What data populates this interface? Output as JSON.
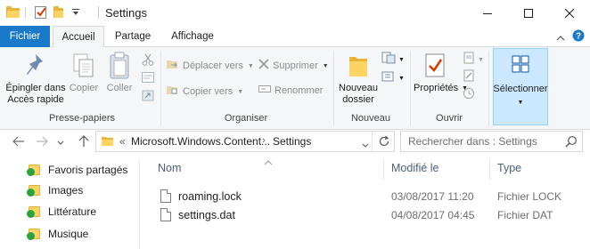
{
  "window": {
    "title": "Settings"
  },
  "ribbon_tabs": [
    "Fichier",
    "Accueil",
    "Partage",
    "Affichage"
  ],
  "ribbon": {
    "pin_line1": "Épingler dans",
    "pin_line2": "Accès rapide",
    "copy": "Copier",
    "paste": "Coller",
    "move_to": "Déplacer vers",
    "copy_to": "Copier vers",
    "delete": "Supprimer",
    "rename": "Renommer",
    "new_folder_line1": "Nouveau",
    "new_folder_line2": "dossier",
    "properties": "Propriétés",
    "select": "Sélectionner",
    "groups": {
      "clipboard": "Presse-papiers",
      "organize": "Organiser",
      "new": "Nouveau",
      "open": "Ouvrir"
    }
  },
  "address": {
    "overflow": "«",
    "segment1": "Microsoft.Windows.Content...",
    "segment2": "Settings",
    "search_placeholder": "Rechercher dans : Settings"
  },
  "nav_items": [
    "Favoris partagés",
    "Images",
    "Littérature",
    "Musique"
  ],
  "columns": {
    "name": "Nom",
    "date": "Modifié le",
    "type": "Type"
  },
  "files": [
    {
      "name": "roaming.lock",
      "date": "03/08/2017 11:20",
      "type": "Fichier LOCK"
    },
    {
      "name": "settings.dat",
      "date": "04/08/2017 04:45",
      "type": "Fichier DAT"
    }
  ],
  "colors": {
    "file_tab": "#1979ca",
    "ribbon_bg": "#f5f6f7",
    "selected": "#cce8ff",
    "folder": "#fcd463",
    "check": "#2aa33b"
  }
}
